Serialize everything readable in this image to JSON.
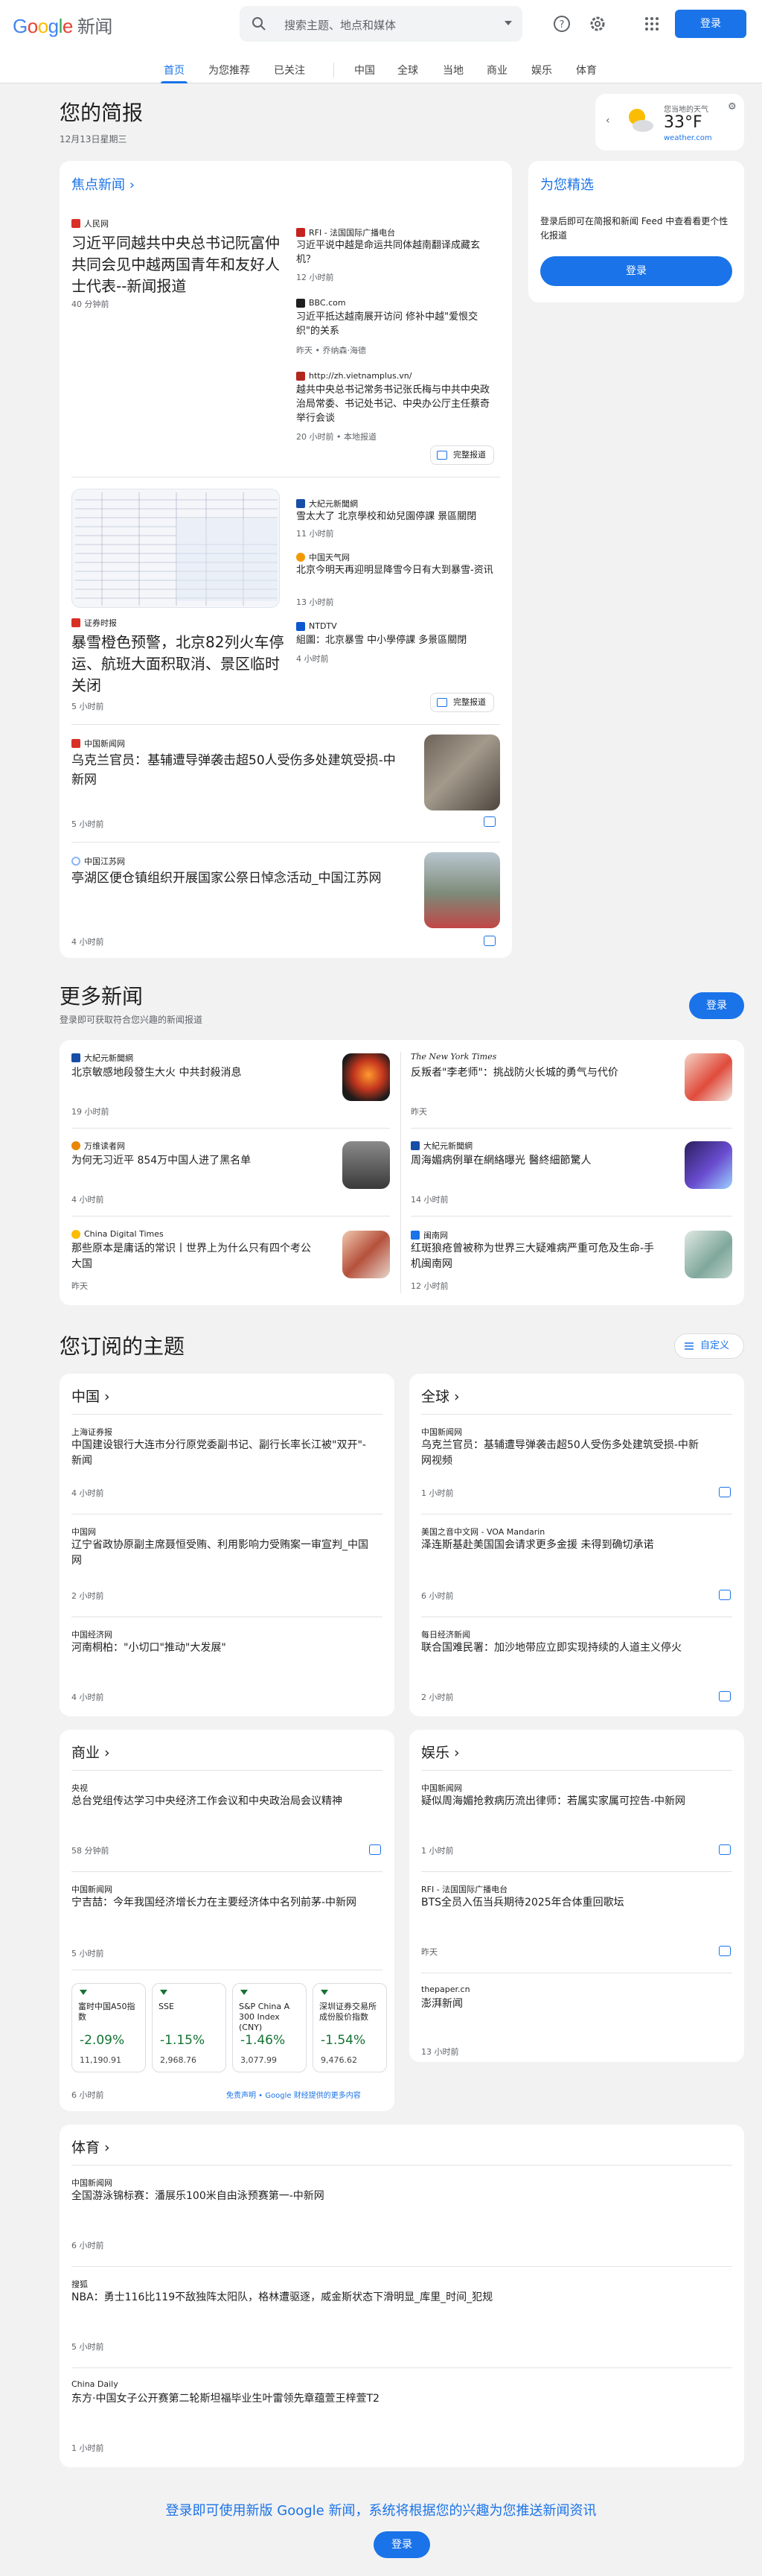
{
  "header": {
    "logo_google": "Google",
    "logo_news": "新闻",
    "search_placeholder": "搜索主题、地点和媒体",
    "signin": "登录"
  },
  "nav": [
    "首页",
    "为您推荐",
    "已关注",
    "中国",
    "全球",
    "当地",
    "商业",
    "娱乐",
    "体育"
  ],
  "briefing": {
    "title": "您的简报",
    "date": "12月13日星期三"
  },
  "weather": {
    "label": "您当地的天气",
    "temp": "33°F",
    "source": "weather.com"
  },
  "top": {
    "title": "焦点新闻",
    "full_coverage": "完整报道",
    "c1": {
      "source": "人民网",
      "title": "习近平同越共中央总书记阮富仲共同会见中越两国青年和友好人士代表--新闻报道",
      "time": "40 分钟前",
      "side": [
        {
          "source": "RFI - 法国国际广播电台",
          "title": "习近平说中越是命运共同体越南翻译成藏玄机？",
          "time": "12 小时前"
        },
        {
          "source": "BBC.com",
          "title": "习近平抵达越南展开访问 修补中越\"爱恨交织\"的关系",
          "time": "昨天 • 乔纳森·海德"
        },
        {
          "source": "http://zh.vietnamplus.vn/",
          "title": "越共中央总书记常务书记张氏梅与中共中央政治局常委、书记处书记、中央办公厅主任蔡奇举行会谈",
          "time": "20 小时前 • 本地报道"
        }
      ]
    },
    "c2": {
      "source": "证券时报",
      "title": "暴雪橙色预警，北京82列火车停运、航班大面积取消、景区临时关闭",
      "time": "5 小时前",
      "side": [
        {
          "source": "大紀元新聞網",
          "title": "雪太大了 北京學校和幼兒園停課 景區關閉",
          "time": "11 小时前"
        },
        {
          "source": "中国天气网",
          "title": "北京今明天再迎明显降雪今日有大到暴雪-资讯",
          "time": "13 小时前"
        },
        {
          "source": "NTDTV",
          "title": "組圖：北京暴雪 中小學停課 多景區關閉",
          "time": "4 小时前"
        }
      ]
    },
    "c3": {
      "source": "中国新闻网",
      "title": "乌克兰官员：基辅遭导弹袭击超50人受伤多处建筑受损-中新网",
      "time": "5 小时前"
    },
    "c4": {
      "source": "中国江苏网",
      "title": "亭湖区便仓镇组织开展国家公祭日悼念活动_中国江苏网",
      "time": "4 小时前"
    }
  },
  "foryou": {
    "title": "为您精选",
    "desc": "登录后即可在简报和新闻 Feed 中查看看更个性化报道",
    "button": "登录"
  },
  "more": {
    "title": "更多新闻",
    "sub": "登录即可获取符合您兴趣的新闻报道",
    "button": "登录",
    "items": [
      {
        "source": "大紀元新聞網",
        "title": "北京敏感地段發生大火 中共封殺消息",
        "time": "19 小时前"
      },
      {
        "source": "The New York Times",
        "title": "反叛者\"李老师\"：挑战防火长城的勇气与代价",
        "time": "昨天"
      },
      {
        "source": "万维读者网",
        "title": "为何无习近平 854万中国人进了黑名单",
        "time": "4 小时前"
      },
      {
        "source": "大紀元新聞網",
        "title": "周海媚病例單在網絡曝光 醫終細節驚人",
        "time": "14 小时前"
      },
      {
        "source": "China Digital Times",
        "title": "那些原本是庸话的常识丨世界上为什么只有四个考公大国",
        "time": "昨天"
      },
      {
        "source": "闽南网",
        "title": "红斑狼疮曾被称为世界三大疑难病严重可危及生命-手机闽南网",
        "time": "12 小时前"
      }
    ]
  },
  "topics": {
    "title": "您订阅的主题",
    "customize": "自定义",
    "china": {
      "title": "中国",
      "items": [
        {
          "source": "上海证券报",
          "title": "中国建设银行大连市分行原党委副书记、副行长率长江被\"双开\"-新闻",
          "time": "4 小时前"
        },
        {
          "source": "中国网",
          "title": "辽宁省政协原副主席聂恒受贿、利用影响力受贿案一审宣判_中国网",
          "time": "2 小时前"
        },
        {
          "source": "中国经济网",
          "title": "河南桐柏：\"小切口\"推动\"大发展\"",
          "time": "4 小时前"
        }
      ]
    },
    "world": {
      "title": "全球",
      "items": [
        {
          "source": "中国新闻网",
          "title": "乌克兰官员：基辅遭导弹袭击超50人受伤多处建筑受损-中新网视频",
          "time": "1 小时前"
        },
        {
          "source": "美国之音中文网 - VOA Mandarin",
          "title": "泽连斯基赴美国国会请求更多金援 未得到确切承诺",
          "time": "6 小时前"
        },
        {
          "source": "每日经济新闻",
          "title": "联合国难民署：加沙地带应立即实现持续的人道主义停火",
          "time": "2 小时前"
        }
      ]
    },
    "business": {
      "title": "商业",
      "items": [
        {
          "source": "央视",
          "title": "总台党组传达学习中央经济工作会议和中央政治局会议精神",
          "time": "58 分钟前"
        },
        {
          "source": "中国新闻网",
          "title": "宁吉喆：今年我国经济增长力在主要经济体中名列前茅-中新网",
          "time": "5 小时前"
        }
      ],
      "stocks": [
        {
          "name": "富时中国A50指数",
          "pct": "-2.09%",
          "val": "11,190.91"
        },
        {
          "name": "SSE",
          "pct": "-1.15%",
          "val": "2,968.76"
        },
        {
          "name": "S&P China A 300 Index (CNY)",
          "pct": "-1.46%",
          "val": "3,077.99"
        },
        {
          "name": "深圳证券交易所成份股价指数",
          "pct": "-1.54%",
          "val": "9,476.62"
        }
      ],
      "stocks_time": "6 小时前",
      "disclaimer": "免责声明 • Google 财经提供的更多内容"
    },
    "ent": {
      "title": "娱乐",
      "items": [
        {
          "source": "中国新闻网",
          "title": "疑似周海媚抢救病历流出律师：若属实家属可控告-中新网",
          "time": "1 小时前"
        },
        {
          "source": "RFI - 法国国际广播电台",
          "title": "BTS全员入伍当兵期待2025年合体重回歌坛",
          "time": "昨天"
        },
        {
          "source": "thepaper.cn",
          "title": "澎湃新闻",
          "time": "13 小时前"
        }
      ]
    },
    "sports": {
      "title": "体育",
      "items": [
        {
          "source": "中国新闻网",
          "title": "全国游泳锦标赛：潘展乐100米自由泳预赛第一-中新网",
          "time": "6 小时前"
        },
        {
          "source": "搜狐",
          "title": "NBA：勇士116比119不敌独阵太阳队，格林遭驱逐，威金斯状态下滑明显_库里_时间_犯规",
          "time": "5 小时前"
        },
        {
          "source": "China Daily",
          "title": "东方·中国女子公开赛第二轮斯坦福毕业生叶雷领先章蕴萱王梓萱T2",
          "time": "1 小时前"
        }
      ]
    }
  },
  "footer": {
    "text": "登录即可使用新版 Google 新闻，系统将根据您的兴趣为您推送新闻资讯",
    "button": "登录"
  }
}
